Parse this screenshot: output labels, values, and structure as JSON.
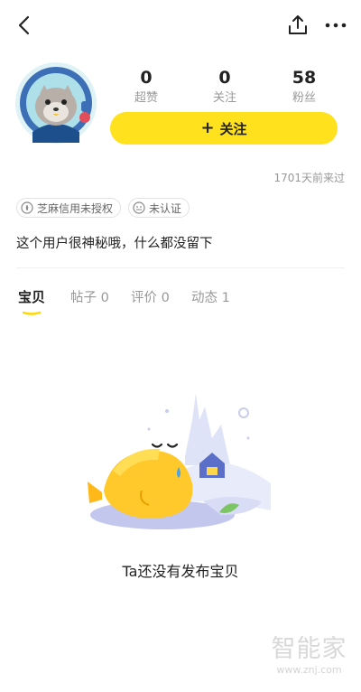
{
  "profile": {
    "stats": [
      {
        "value": "0",
        "label": "超赞"
      },
      {
        "value": "0",
        "label": "关注"
      },
      {
        "value": "58",
        "label": "粉丝"
      }
    ],
    "follow_label": "关注",
    "last_visit": "1701天前来过",
    "badges": [
      {
        "label": "芝麻信用未授权",
        "icon": "sesame-credit-icon"
      },
      {
        "label": "未认证",
        "icon": "unverified-face-icon"
      }
    ],
    "bio": "这个用户很神秘哦，什么都没留下"
  },
  "tabs": [
    {
      "label": "宝贝",
      "active": true
    },
    {
      "label": "帖子 0",
      "active": false
    },
    {
      "label": "评价 0",
      "active": false
    },
    {
      "label": "动态 1",
      "active": false
    }
  ],
  "empty_state": {
    "message": "Ta还没有发布宝贝"
  },
  "watermark": {
    "title": "智能家",
    "url": "www.znj.com"
  },
  "colors": {
    "accent": "#ffe11d",
    "text": "#222222",
    "muted": "#999999"
  }
}
